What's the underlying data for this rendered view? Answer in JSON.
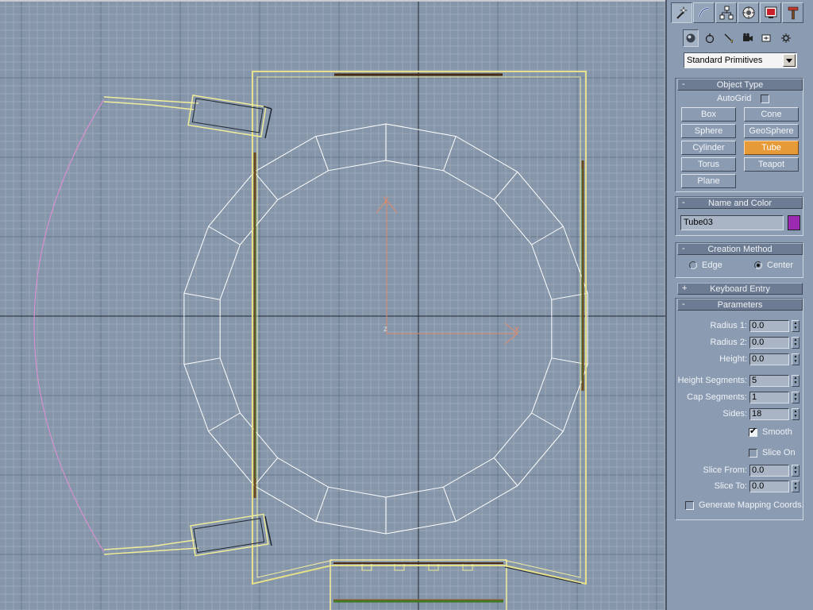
{
  "colors": {
    "viewport_bg": "#8596aa",
    "grid_minor": "#9aa7b6",
    "grid_major": "#6b7788",
    "wireframe": "#ffffff",
    "wall": "#e6e08a",
    "accent": "#e79a38",
    "object_color": "#9c2ab0",
    "arc": "#e38fd6"
  },
  "tabs": [
    {
      "icon": "create-icon",
      "active": true
    },
    {
      "icon": "modify-icon",
      "active": false
    },
    {
      "icon": "hierarchy-icon",
      "active": false
    },
    {
      "icon": "motion-icon",
      "active": false
    },
    {
      "icon": "display-icon",
      "active": false
    },
    {
      "icon": "utilities-icon",
      "active": false
    }
  ],
  "subtabs": [
    {
      "icon": "geometry-icon",
      "active": true
    },
    {
      "icon": "shapes-icon",
      "active": false
    },
    {
      "icon": "lights-icon",
      "active": false
    },
    {
      "icon": "cameras-icon",
      "active": false
    },
    {
      "icon": "helpers-icon",
      "active": false
    },
    {
      "icon": "space-warps-icon",
      "active": false
    }
  ],
  "category_dropdown": {
    "value": "Standard Primitives"
  },
  "object_type": {
    "title": "Object Type",
    "sign": "-",
    "autogrid_label": "AutoGrid",
    "autogrid_checked": false,
    "buttons": [
      {
        "label": "Box",
        "active": false
      },
      {
        "label": "Cone",
        "active": false
      },
      {
        "label": "Sphere",
        "active": false
      },
      {
        "label": "GeoSphere",
        "active": false
      },
      {
        "label": "Cylinder",
        "active": false
      },
      {
        "label": "Tube",
        "active": true
      },
      {
        "label": "Torus",
        "active": false
      },
      {
        "label": "Teapot",
        "active": false
      },
      {
        "label": "Plane",
        "active": false
      }
    ]
  },
  "name_and_color": {
    "title": "Name and Color",
    "sign": "-",
    "name": "Tube03",
    "color": "#9c2ab0"
  },
  "creation_method": {
    "title": "Creation Method",
    "sign": "-",
    "options": [
      "Edge",
      "Center"
    ],
    "selected": "Center"
  },
  "keyboard_entry": {
    "title": "Keyboard Entry",
    "sign": "+"
  },
  "parameters": {
    "title": "Parameters",
    "sign": "-",
    "radius1_label": "Radius 1:",
    "radius1": "0.0",
    "radius2_label": "Radius 2:",
    "radius2": "0.0",
    "height_label": "Height:",
    "height": "0.0",
    "height_segments_label": "Height Segments:",
    "height_segments": "5",
    "cap_segments_label": "Cap Segments:",
    "cap_segments": "1",
    "sides_label": "Sides:",
    "sides": "18",
    "smooth_label": "Smooth",
    "smooth": true,
    "slice_on_label": "Slice On",
    "slice_on": false,
    "slice_from_label": "Slice From:",
    "slice_from": "0.0",
    "slice_to_label": "Slice To:",
    "slice_to": "0.0",
    "mapping_label": "Generate Mapping Coords.",
    "mapping": false
  },
  "gizmo": {
    "x_label": "x",
    "y_label": "y",
    "z_label": "z"
  }
}
